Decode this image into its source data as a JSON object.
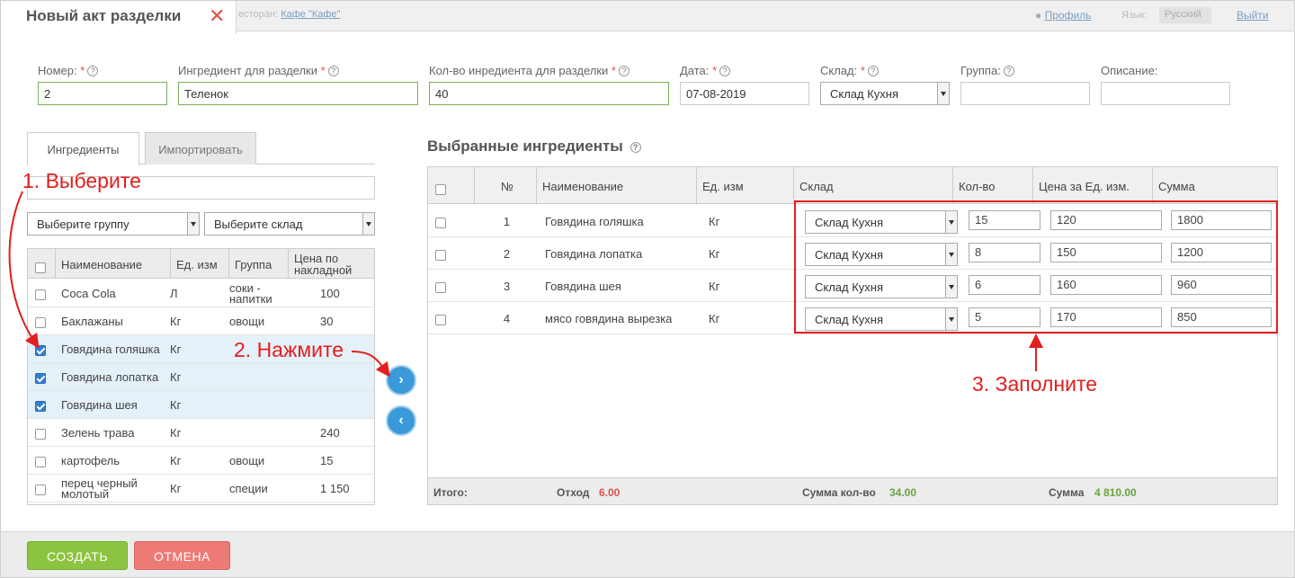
{
  "header": {
    "title": "Новый акт разделки",
    "restaurant_label": "естoран:",
    "restaurant_link": "Кафе \"Кафе\"",
    "profile": "Профиль",
    "lang_label": "Язык:",
    "lang_value": "Русский",
    "logout": "Выйти"
  },
  "form": {
    "number": {
      "label": "Номер:",
      "value": "2"
    },
    "ingredient": {
      "label": "Ингредиент для разделки",
      "value": "Теленок"
    },
    "qty": {
      "label": "Кол-во инредиента для разделки",
      "value": "40"
    },
    "date": {
      "label": "Дата:",
      "value": "07-08-2019"
    },
    "warehouse": {
      "label": "Склад:",
      "value": "Склад Кухня"
    },
    "group": {
      "label": "Группа:",
      "value": ""
    },
    "description": {
      "label": "Описание:",
      "value": ""
    }
  },
  "tabs": [
    "Ингредиенты",
    "Импортировать"
  ],
  "filters": {
    "group": "Выберите группу",
    "warehouse": "Выберите склад"
  },
  "left_table": {
    "headers": [
      "Наименование",
      "Ед. изм",
      "Группа",
      "Цена по накладной"
    ],
    "rows": [
      {
        "name": "Coca Cola",
        "unit": "Л",
        "group": "соки - напитки",
        "price": "100",
        "checked": false
      },
      {
        "name": "Баклажаны",
        "unit": "Кг",
        "group": "овощи",
        "price": "30",
        "checked": false
      },
      {
        "name": "Говядина голяшка",
        "unit": "Кг",
        "group": "",
        "price": "",
        "checked": true
      },
      {
        "name": "Говядина лопатка",
        "unit": "Кг",
        "group": "",
        "price": "",
        "checked": true
      },
      {
        "name": "Говядина шея",
        "unit": "Кг",
        "group": "",
        "price": "",
        "checked": true
      },
      {
        "name": "Зелень трава",
        "unit": "Кг",
        "group": "",
        "price": "240",
        "checked": false
      },
      {
        "name": "картофель",
        "unit": "Кг",
        "group": "овощи",
        "price": "15",
        "checked": false
      },
      {
        "name": "перец черный молотый",
        "unit": "Кг",
        "group": "специи",
        "price": "1 150",
        "checked": false
      }
    ]
  },
  "selected": {
    "title": "Выбранные ингредиенты",
    "headers": [
      "№",
      "Наименование",
      "Ед. изм",
      "Склад",
      "Кол-во",
      "Цена за Ед. изм.",
      "Сумма"
    ],
    "rows": [
      {
        "n": "1",
        "name": "Говядина голяшка",
        "unit": "Кг",
        "wh": "Склад Кухня",
        "qty": "15",
        "price": "120",
        "sum": "1800"
      },
      {
        "n": "2",
        "name": "Говядина лопатка",
        "unit": "Кг",
        "wh": "Склад Кухня",
        "qty": "8",
        "price": "150",
        "sum": "1200"
      },
      {
        "n": "3",
        "name": "Говядина шея",
        "unit": "Кг",
        "wh": "Склад Кухня",
        "qty": "6",
        "price": "160",
        "sum": "960"
      },
      {
        "n": "4",
        "name": "мясо говядина вырезка",
        "unit": "Кг",
        "wh": "Склад Кухня",
        "qty": "5",
        "price": "170",
        "sum": "850"
      }
    ],
    "footer": {
      "total_label": "Итого:",
      "waste_label": "Отход",
      "waste_value": "6.00",
      "qty_label": "Сумма кол-во",
      "qty_value": "34.00",
      "sum_label": "Сумма",
      "sum_value": "4 810.00"
    }
  },
  "annotations": {
    "step1": "1. Выберите",
    "step2": "2. Нажмите",
    "step3": "3. Заполните"
  },
  "buttons": {
    "create": "СОЗДАТЬ",
    "cancel": "ОТМЕНА"
  },
  "colors": {
    "accent_red": "#e21e1e",
    "create_green": "#8cc43f",
    "cancel_red": "#ee7a76",
    "arrow_blue": "#3a9ad9"
  }
}
